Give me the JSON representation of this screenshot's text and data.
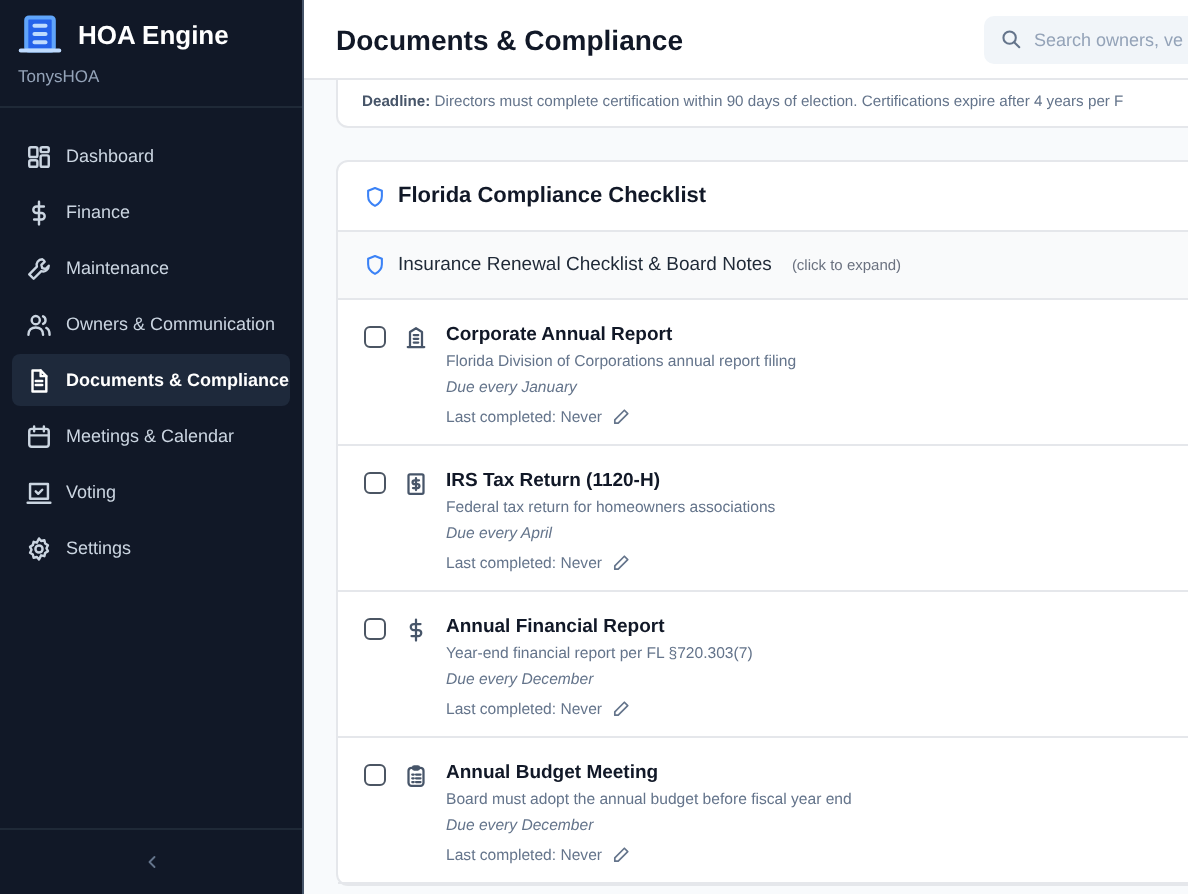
{
  "sidebar": {
    "app_name": "HOA Engine",
    "org_name": "TonysHOA",
    "items": [
      {
        "label": "Dashboard",
        "selected": false
      },
      {
        "label": "Finance",
        "selected": false
      },
      {
        "label": "Maintenance",
        "selected": false
      },
      {
        "label": "Owners & Communication",
        "selected": false
      },
      {
        "label": "Documents & Compliance",
        "selected": true
      },
      {
        "label": "Meetings & Calendar",
        "selected": false
      },
      {
        "label": "Voting",
        "selected": false
      },
      {
        "label": "Settings",
        "selected": false
      }
    ]
  },
  "header": {
    "title": "Documents & Compliance",
    "search": {
      "placeholder": "Search owners, ve"
    }
  },
  "deadline_note": "**Deadline:** Directors must complete certification within 90 days of election. Certifications expire after 4 years per F",
  "checklist": {
    "title": "Florida Compliance Checklist",
    "insurance": {
      "title": "Insurance Renewal Checklist & Board Notes",
      "hint": "(click to expand)"
    },
    "items": [
      {
        "kind": "building",
        "title": "Corporate Annual Report",
        "description": "Florida Division of Corporations annual report filing",
        "due": "Due every January",
        "last_completed": "Last completed: Never",
        "checked": false
      },
      {
        "kind": "receipt",
        "title": "IRS Tax Return (1120-H)",
        "description": "Federal tax return for homeowners associations",
        "due": "Due every April",
        "last_completed": "Last completed: Never",
        "checked": false
      },
      {
        "kind": "dollar",
        "title": "Annual Financial Report",
        "description": "Year-end financial report per FL §720.303(7)",
        "due": "Due every December",
        "last_completed": "Last completed: Never",
        "checked": false
      },
      {
        "kind": "clipboard",
        "title": "Annual Budget Meeting",
        "description": "Board must adopt the annual budget before fiscal year end",
        "due": "Due every December",
        "last_completed": "Last completed: Never",
        "checked": false
      }
    ]
  }
}
